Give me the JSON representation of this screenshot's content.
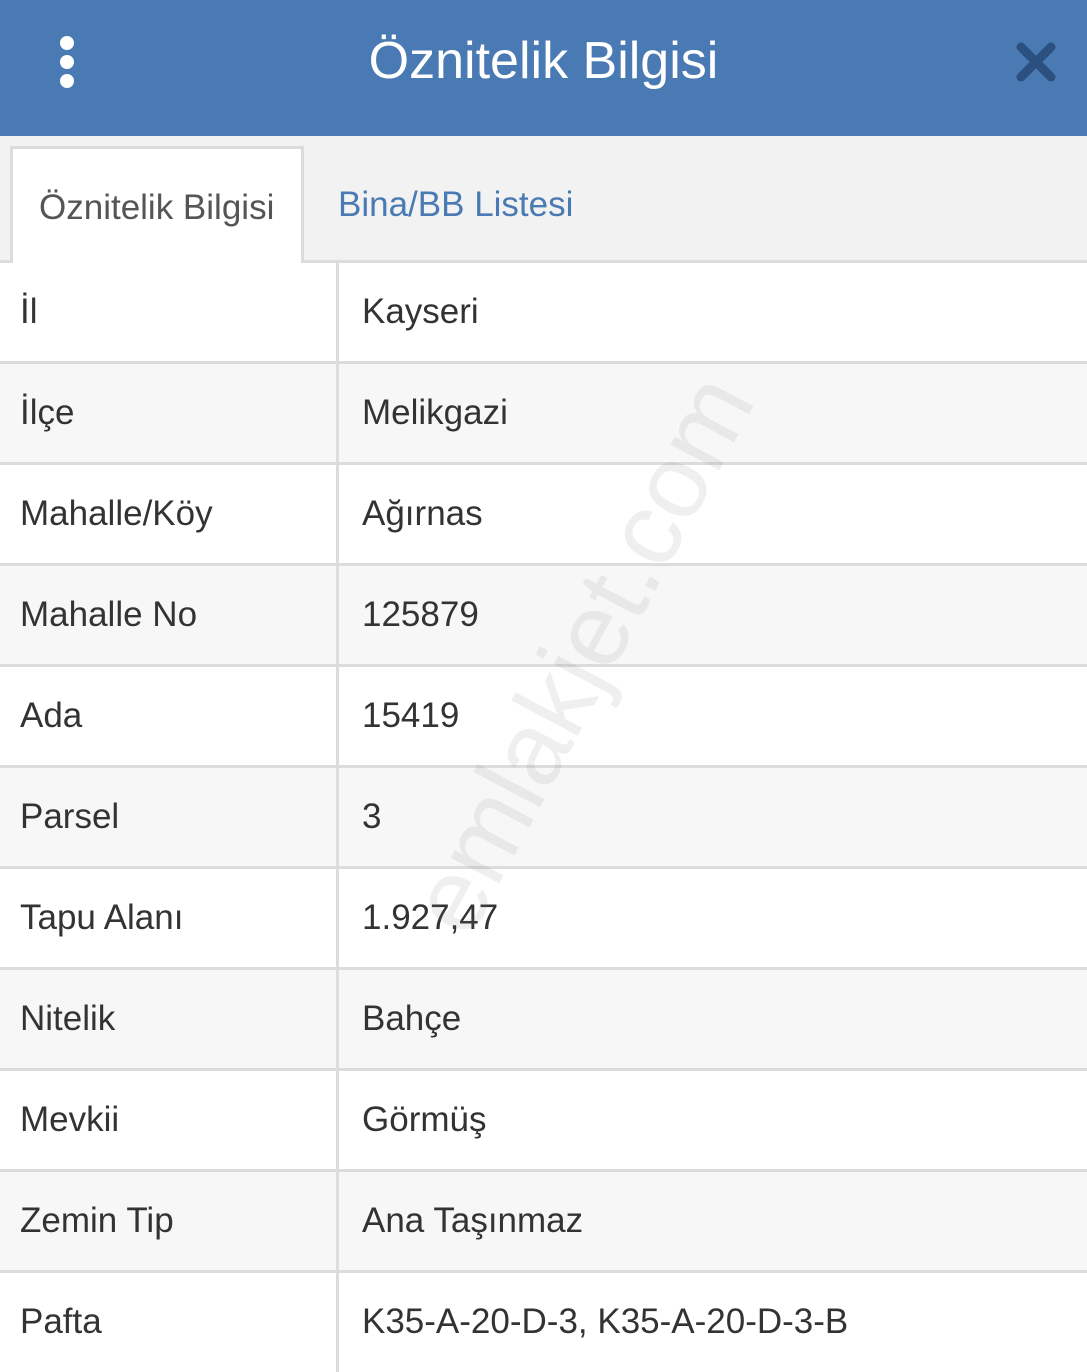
{
  "header": {
    "title": "Öznitelik Bilgisi",
    "menu_icon": "more-vertical-icon",
    "close_icon": "close-icon",
    "background_color": "#4a7ab3"
  },
  "tabs": [
    {
      "label": "Öznitelik Bilgisi",
      "active": true
    },
    {
      "label": "Bina/BB Listesi",
      "active": false
    }
  ],
  "rows": [
    {
      "label": "İl",
      "value": "Kayseri"
    },
    {
      "label": "İlçe",
      "value": "Melikgazi"
    },
    {
      "label": "Mahalle/Köy",
      "value": "Ağırnas"
    },
    {
      "label": "Mahalle No",
      "value": "125879"
    },
    {
      "label": "Ada",
      "value": "15419"
    },
    {
      "label": "Parsel",
      "value": "3"
    },
    {
      "label": "Tapu Alanı",
      "value": "1.927,47"
    },
    {
      "label": "Nitelik",
      "value": "Bahçe"
    },
    {
      "label": "Mevkii",
      "value": "Görmüş"
    },
    {
      "label": "Zemin Tip",
      "value": "Ana Taşınmaz"
    },
    {
      "label": "Pafta",
      "value": "K35-A-20-D-3, K35-A-20-D-3-B"
    }
  ],
  "watermark": "emlakjet.com"
}
